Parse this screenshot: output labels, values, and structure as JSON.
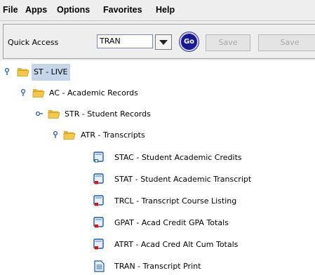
{
  "menu": {
    "file": "File",
    "apps": "Apps",
    "options": "Options",
    "favorites": "Favorites",
    "help": "Help"
  },
  "toolbar": {
    "quick_access_label": "Quick Access",
    "quick_access_value": "TRAN",
    "go_label": "Go",
    "save_label": "Save",
    "save_label_2": "Save"
  },
  "tree": {
    "root": {
      "label": "ST - LIVE",
      "expanded": true,
      "selected": true
    },
    "ac": {
      "label": "AC - Academic Records",
      "expanded": true
    },
    "str": {
      "label": "STR - Student Records",
      "expanded": false
    },
    "atr": {
      "label": "ATR - Transcripts",
      "expanded": true
    },
    "leaves": [
      {
        "label": "STAC - Student Academic Credits",
        "icon": "form-icon"
      },
      {
        "label": "STAT - Student Academic Transcript",
        "icon": "form-red-icon"
      },
      {
        "label": "TRCL - Transcript Course Listing",
        "icon": "form-red-icon"
      },
      {
        "label": "GPAT - Acad Credit GPA Totals",
        "icon": "form-red-icon"
      },
      {
        "label": "ATRT - Acad Cred Alt Cum Totals",
        "icon": "form-red-icon"
      },
      {
        "label": "TRAN - Transcript Print",
        "icon": "document-icon"
      }
    ]
  },
  "colors": {
    "selection": "#c6d5ea",
    "folder": "#f2c94c",
    "go_button": "#1a1a90",
    "icon_blue": "#1c5aa8",
    "icon_red": "#d01818"
  }
}
